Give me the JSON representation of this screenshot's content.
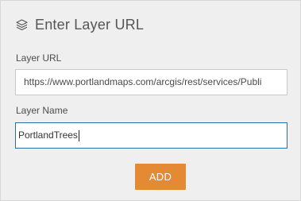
{
  "header": {
    "title": "Enter Layer URL",
    "icon": "layers-icon"
  },
  "form": {
    "url_label": "Layer URL",
    "url_value": "https://www.portlandmaps.com/arcgis/rest/services/Publi",
    "name_label": "Layer Name",
    "name_value": "PortlandTrees"
  },
  "actions": {
    "add_label": "ADD"
  },
  "colors": {
    "accent": "#e48a34",
    "focus_border": "#2b6fa8",
    "panel_bg": "#efefef"
  }
}
